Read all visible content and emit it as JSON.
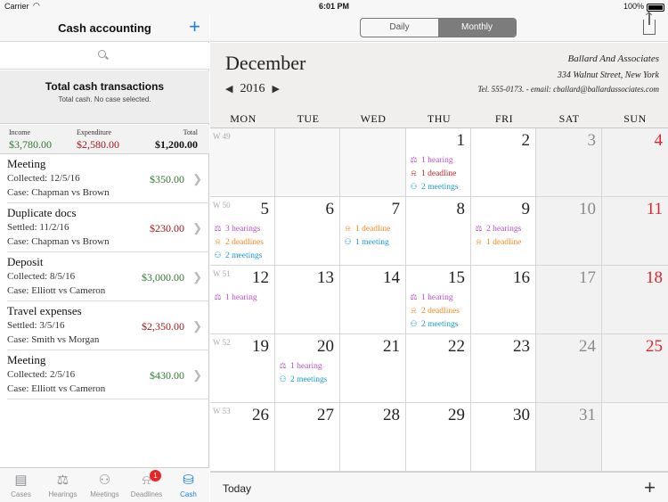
{
  "status": {
    "carrier": "Carrier",
    "time": "6:01 PM",
    "battery": "100%"
  },
  "left": {
    "title": "Cash accounting",
    "add_label": "+",
    "summary": {
      "title": "Total cash transactions",
      "subtitle": "Total cash. No case selected."
    },
    "totals": {
      "income_label": "Income",
      "income": "$3,780.00",
      "expenditure_label": "Expenditure",
      "expenditure": "$2,580.00",
      "total_label": "Total",
      "total": "$1,200.00"
    },
    "items": [
      {
        "name": "Meeting",
        "sub": "Collected: 12/5/16",
        "case": "Case: Chapman vs Brown",
        "amount": "$350.00",
        "kind": "income"
      },
      {
        "name": "Duplicate docs",
        "sub": "Settled: 11/2/16",
        "case": "Case: Chapman vs Brown",
        "amount": "$230.00",
        "kind": "expense"
      },
      {
        "name": "Deposit",
        "sub": "Collected: 8/5/16",
        "case": "Case: Elliott vs Cameron",
        "amount": "$3,000.00",
        "kind": "income"
      },
      {
        "name": "Travel expenses",
        "sub": "Settled: 3/5/16",
        "case": "Case: Smith vs Morgan",
        "amount": "$2,350.00",
        "kind": "expense"
      },
      {
        "name": "Meeting",
        "sub": "Collected: 2/5/16",
        "case": "Case: Elliott vs Cameron",
        "amount": "$430.00",
        "kind": "income"
      }
    ],
    "tabs": [
      {
        "label": "Cases",
        "icon": "cases-icon"
      },
      {
        "label": "Hearings",
        "icon": "scales-icon"
      },
      {
        "label": "Meetings",
        "icon": "people-icon"
      },
      {
        "label": "Deadlines",
        "icon": "bell-icon",
        "badge": "1"
      },
      {
        "label": "Cash",
        "icon": "coins-icon",
        "active": true
      }
    ]
  },
  "right": {
    "segments": [
      "Daily",
      "Monthly"
    ],
    "selected_segment": "Monthly",
    "month": "December",
    "year": "2016",
    "firm": {
      "name": "Ballard And Associates",
      "address": "334 Walnut Street, New York",
      "contact": "Tel. 555-0173. - email: cballard@ballardassociates.com"
    },
    "weekdays": [
      "MON",
      "TUE",
      "WED",
      "THU",
      "FRI",
      "SAT",
      "SUN"
    ],
    "weeks": [
      {
        "label": "W 49",
        "days": [
          "",
          "",
          "",
          "1",
          "2",
          "3",
          "4"
        ]
      },
      {
        "label": "W 50",
        "days": [
          "5",
          "6",
          "7",
          "8",
          "9",
          "10",
          "11"
        ]
      },
      {
        "label": "W 51",
        "days": [
          "12",
          "13",
          "14",
          "15",
          "16",
          "17",
          "18"
        ]
      },
      {
        "label": "W 52",
        "days": [
          "19",
          "20",
          "21",
          "22",
          "23",
          "24",
          "25"
        ]
      },
      {
        "label": "W 53",
        "days": [
          "26",
          "27",
          "28",
          "29",
          "30",
          "31",
          ""
        ]
      }
    ],
    "events": [
      {
        "week": 0,
        "day": 3,
        "items": [
          {
            "type": "hearing",
            "text": "1 hearing"
          },
          {
            "type": "deadline-red",
            "text": "1 deadline"
          },
          {
            "type": "meeting",
            "text": "2 meetings"
          }
        ]
      },
      {
        "week": 1,
        "day": 0,
        "items": [
          {
            "type": "hearing",
            "text": "3 hearings"
          },
          {
            "type": "deadline",
            "text": "2 deadlines"
          },
          {
            "type": "meeting",
            "text": "2 meetings"
          }
        ]
      },
      {
        "week": 1,
        "day": 2,
        "items": [
          {
            "type": "deadline",
            "text": "1 deadline"
          },
          {
            "type": "meeting",
            "text": "1 meeting"
          }
        ]
      },
      {
        "week": 1,
        "day": 4,
        "items": [
          {
            "type": "hearing",
            "text": "2 hearings"
          },
          {
            "type": "deadline",
            "text": "1 deadline"
          }
        ]
      },
      {
        "week": 2,
        "day": 0,
        "items": [
          {
            "type": "hearing",
            "text": "1 hearing"
          }
        ]
      },
      {
        "week": 2,
        "day": 3,
        "items": [
          {
            "type": "hearing",
            "text": "1 hearing"
          },
          {
            "type": "deadline",
            "text": "2 deadlines"
          },
          {
            "type": "meeting",
            "text": "2 meetings"
          }
        ]
      },
      {
        "week": 3,
        "day": 1,
        "items": [
          {
            "type": "hearing",
            "text": "1 hearing"
          },
          {
            "type": "meeting",
            "text": "2 meetings"
          }
        ]
      }
    ],
    "today_label": "Today",
    "add_label": "+"
  }
}
